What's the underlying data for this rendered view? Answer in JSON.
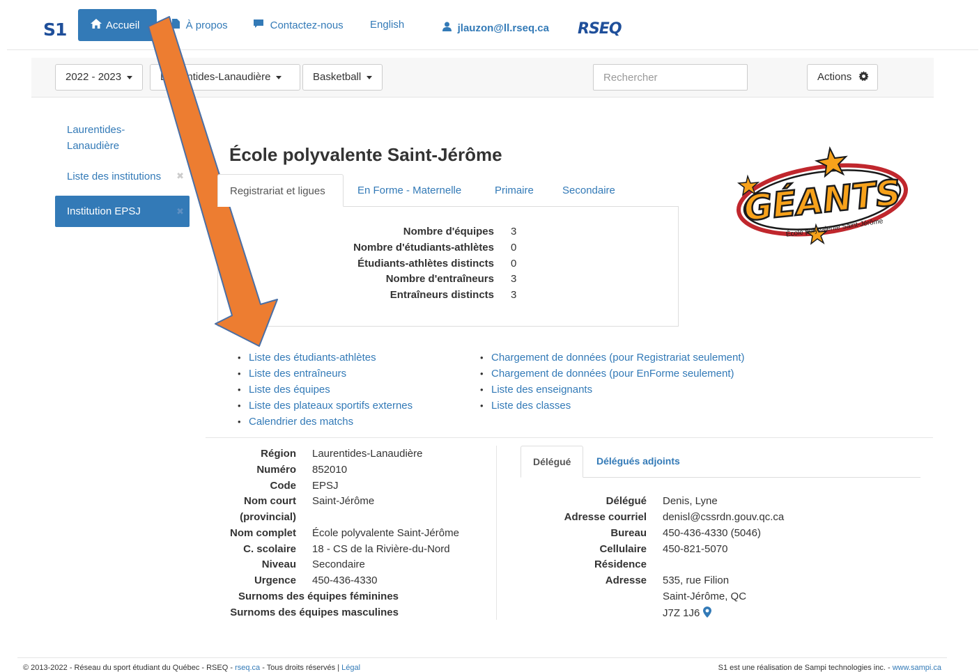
{
  "nav": {
    "logo": "S1",
    "home_label": "Accueil",
    "about_label": "À propos",
    "contact_label": "Contactez-nous",
    "language_label": "English",
    "user_label": "jlauzon@ll.rseq.ca",
    "brand_logo": "RSEQ"
  },
  "toolbar": {
    "season": "2022 - 2023",
    "region": "Laurentides-Lanaudière",
    "sport": "Basketball",
    "search_placeholder": "Rechercher",
    "actions_label": "Actions"
  },
  "sidebar": {
    "items": [
      {
        "label": "Laurentides-Lanaudière"
      },
      {
        "label": "Liste des institutions"
      },
      {
        "label": "Institution EPSJ"
      }
    ],
    "close_glyph": "✖"
  },
  "page": {
    "title": "École polyvalente Saint-Jérôme",
    "logo_text": "GÉANTS",
    "logo_subtext": "École polyvalente Saint-Jérôme"
  },
  "tabs": [
    {
      "label": "Registrariat et ligues",
      "active": true
    },
    {
      "label": "En Forme - Maternelle"
    },
    {
      "label": "Primaire"
    },
    {
      "label": "Secondaire"
    }
  ],
  "stats": [
    {
      "label": "Nombre d'équipes",
      "value": "3"
    },
    {
      "label": "Nombre d'étudiants-athlètes",
      "value": "0"
    },
    {
      "label": "Étudiants-athlètes distincts",
      "value": "0"
    },
    {
      "label": "Nombre d'entraîneurs",
      "value": "3"
    },
    {
      "label": "Entraîneurs distincts",
      "value": "3"
    }
  ],
  "links_left": [
    "Liste des étudiants-athlètes",
    "Liste des entraîneurs",
    "Liste des équipes",
    "Liste des plateaux sportifs externes",
    "Calendrier des matchs"
  ],
  "links_right": [
    "Chargement de données (pour Registrariat seulement)",
    "Chargement de données (pour EnForme seulement)",
    "Liste des enseignants",
    "Liste des classes"
  ],
  "institution": {
    "region_label": "Région",
    "region": "Laurentides-Lanaudière",
    "numero_label": "Numéro",
    "numero": "852010",
    "code_label": "Code",
    "code": "EPSJ",
    "nom_court_label_1": "Nom court",
    "nom_court_label_2": "(provincial)",
    "nom_court": "Saint-Jérôme",
    "nom_complet_label": "Nom complet",
    "nom_complet": "École polyvalente Saint-Jérôme",
    "scolaire_label": "C. scolaire",
    "scolaire": "18 - CS de la Rivière-du-Nord",
    "niveau_label": "Niveau",
    "niveau": "Secondaire",
    "urgence_label": "Urgence",
    "urgence": "450-436-4330",
    "surnoms_f_label": "Surnoms des équipes féminines",
    "surnoms_m_label": "Surnoms des équipes masculines"
  },
  "delegue_tabs": [
    {
      "label": "Délégué",
      "active": true
    },
    {
      "label": "Délégués adjoints"
    }
  ],
  "delegue": {
    "nom_label": "Délégué",
    "nom": "Denis, Lyne",
    "courriel_label": "Adresse courriel",
    "courriel": "denisl@cssrdn.gouv.qc.ca",
    "bureau_label": "Bureau",
    "bureau": "450-436-4330 (5046)",
    "cellulaire_label": "Cellulaire",
    "cellulaire": "450-821-5070",
    "residence_label": "Résidence",
    "adresse_label": "Adresse",
    "adresse_1": "535, rue Filion",
    "adresse_2": "Saint-Jérôme, QC",
    "adresse_3": "J7Z 1J6"
  },
  "footer": {
    "left_text": "© 2013-2022 - Réseau du sport étudiant du Québec - RSEQ - ",
    "left_link": "rseq.ca",
    "left_text_2": " - Tous droits réservés | ",
    "legal_link": "Légal",
    "right_text": "S1 est une réalisation de Sampi technologies inc. - ",
    "right_link": "www.sampi.ca"
  },
  "colors": {
    "primary": "#337ab7",
    "arrow_fill": "#ed7d31",
    "arrow_stroke": "#4a6fa5"
  }
}
